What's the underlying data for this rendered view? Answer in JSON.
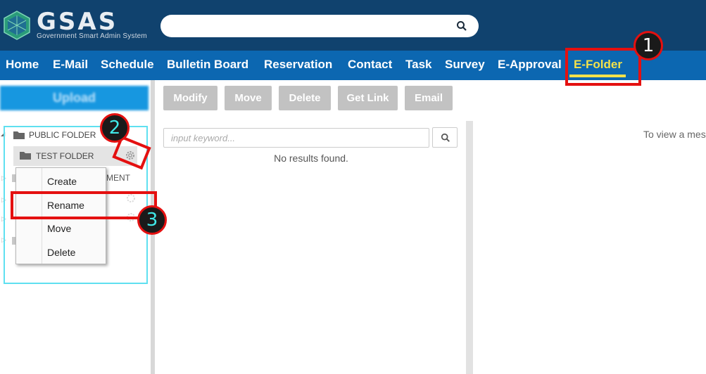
{
  "header": {
    "logo_text": "GSAS",
    "logo_subtitle": "Government Smart Admin System",
    "search_value": ""
  },
  "nav": {
    "items": [
      {
        "label": "Home"
      },
      {
        "label": "E-Mail"
      },
      {
        "label": "Schedule"
      },
      {
        "label": "Bulletin Board"
      },
      {
        "label": "Reservation"
      },
      {
        "label": "Contact"
      },
      {
        "label": "Task"
      },
      {
        "label": "Survey"
      },
      {
        "label": "E-Approval"
      },
      {
        "label": "E-Folder"
      }
    ],
    "active": "E-Folder"
  },
  "sidebar": {
    "upload_label": "Upload",
    "tree": {
      "public_folder": "PUBLIC FOLDER",
      "test_folder": "TEST FOLDER",
      "partial_label": "MENT"
    },
    "context_menu": [
      "Create",
      "Rename",
      "Move",
      "Delete"
    ]
  },
  "toolbar": {
    "buttons": [
      "Modify",
      "Move",
      "Delete",
      "Get Link",
      "Email"
    ]
  },
  "list": {
    "keyword_placeholder": "input keyword...",
    "empty_text": "No results found."
  },
  "viewer": {
    "message": "To view a mes"
  },
  "annotations": {
    "badges": [
      "1",
      "2",
      "3"
    ]
  },
  "colors": {
    "header_bg": "#10426e",
    "nav_bg": "#0c67b1",
    "active_nav": "#f4e24a",
    "upload_bg": "#1797e0",
    "annotation_red": "#e41010",
    "annotation_cyan": "#5fe0f0"
  }
}
